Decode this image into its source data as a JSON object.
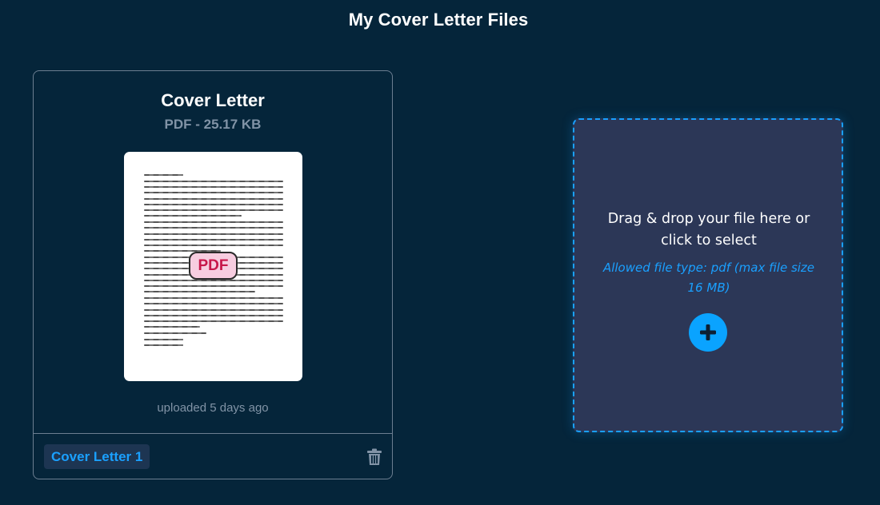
{
  "page": {
    "title": "My Cover Letter Files"
  },
  "file_card": {
    "title": "Cover Letter",
    "meta": "PDF - 25.17 KB",
    "thumbnail_badge": "PDF",
    "uploaded": "uploaded 5 days ago",
    "tag": "Cover Letter 1",
    "icons": {
      "delete": "trash-icon",
      "badge": "pdf-icon"
    }
  },
  "dropzone": {
    "main_text": "Drag & drop your file here or click to select",
    "hint_text": "Allowed file type: pdf (max file size 16 MB)",
    "icons": {
      "add": "plus-icon"
    }
  },
  "colors": {
    "background": "#05253a",
    "accent": "#1aa0ff",
    "dropzone_bg": "#2c3757",
    "muted_text": "#8193a6",
    "pdf_badge_bg": "#f7cde0",
    "pdf_badge_text": "#c7174a"
  }
}
